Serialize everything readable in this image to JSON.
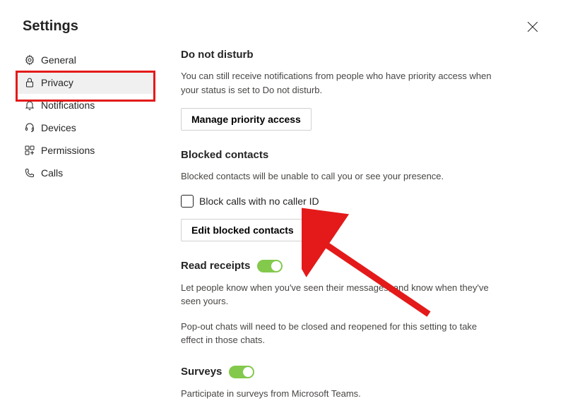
{
  "header": {
    "title": "Settings"
  },
  "sidebar": {
    "items": [
      {
        "label": "General"
      },
      {
        "label": "Privacy"
      },
      {
        "label": "Notifications"
      },
      {
        "label": "Devices"
      },
      {
        "label": "Permissions"
      },
      {
        "label": "Calls"
      }
    ]
  },
  "sections": {
    "dnd": {
      "title": "Do not disturb",
      "desc": "You can still receive notifications from people who have priority access when your status is set to Do not disturb.",
      "button": "Manage priority access"
    },
    "blocked": {
      "title": "Blocked contacts",
      "desc": "Blocked contacts will be unable to call you or see your presence.",
      "checkbox": "Block calls with no caller ID",
      "button": "Edit blocked contacts"
    },
    "read": {
      "title": "Read receipts",
      "desc1": "Let people know when you've seen their messages, and know when they've seen yours.",
      "desc2": "Pop-out chats will need to be closed and reopened for this setting to take effect in those chats."
    },
    "surveys": {
      "title": "Surveys",
      "desc": "Participate in surveys from Microsoft Teams."
    }
  }
}
